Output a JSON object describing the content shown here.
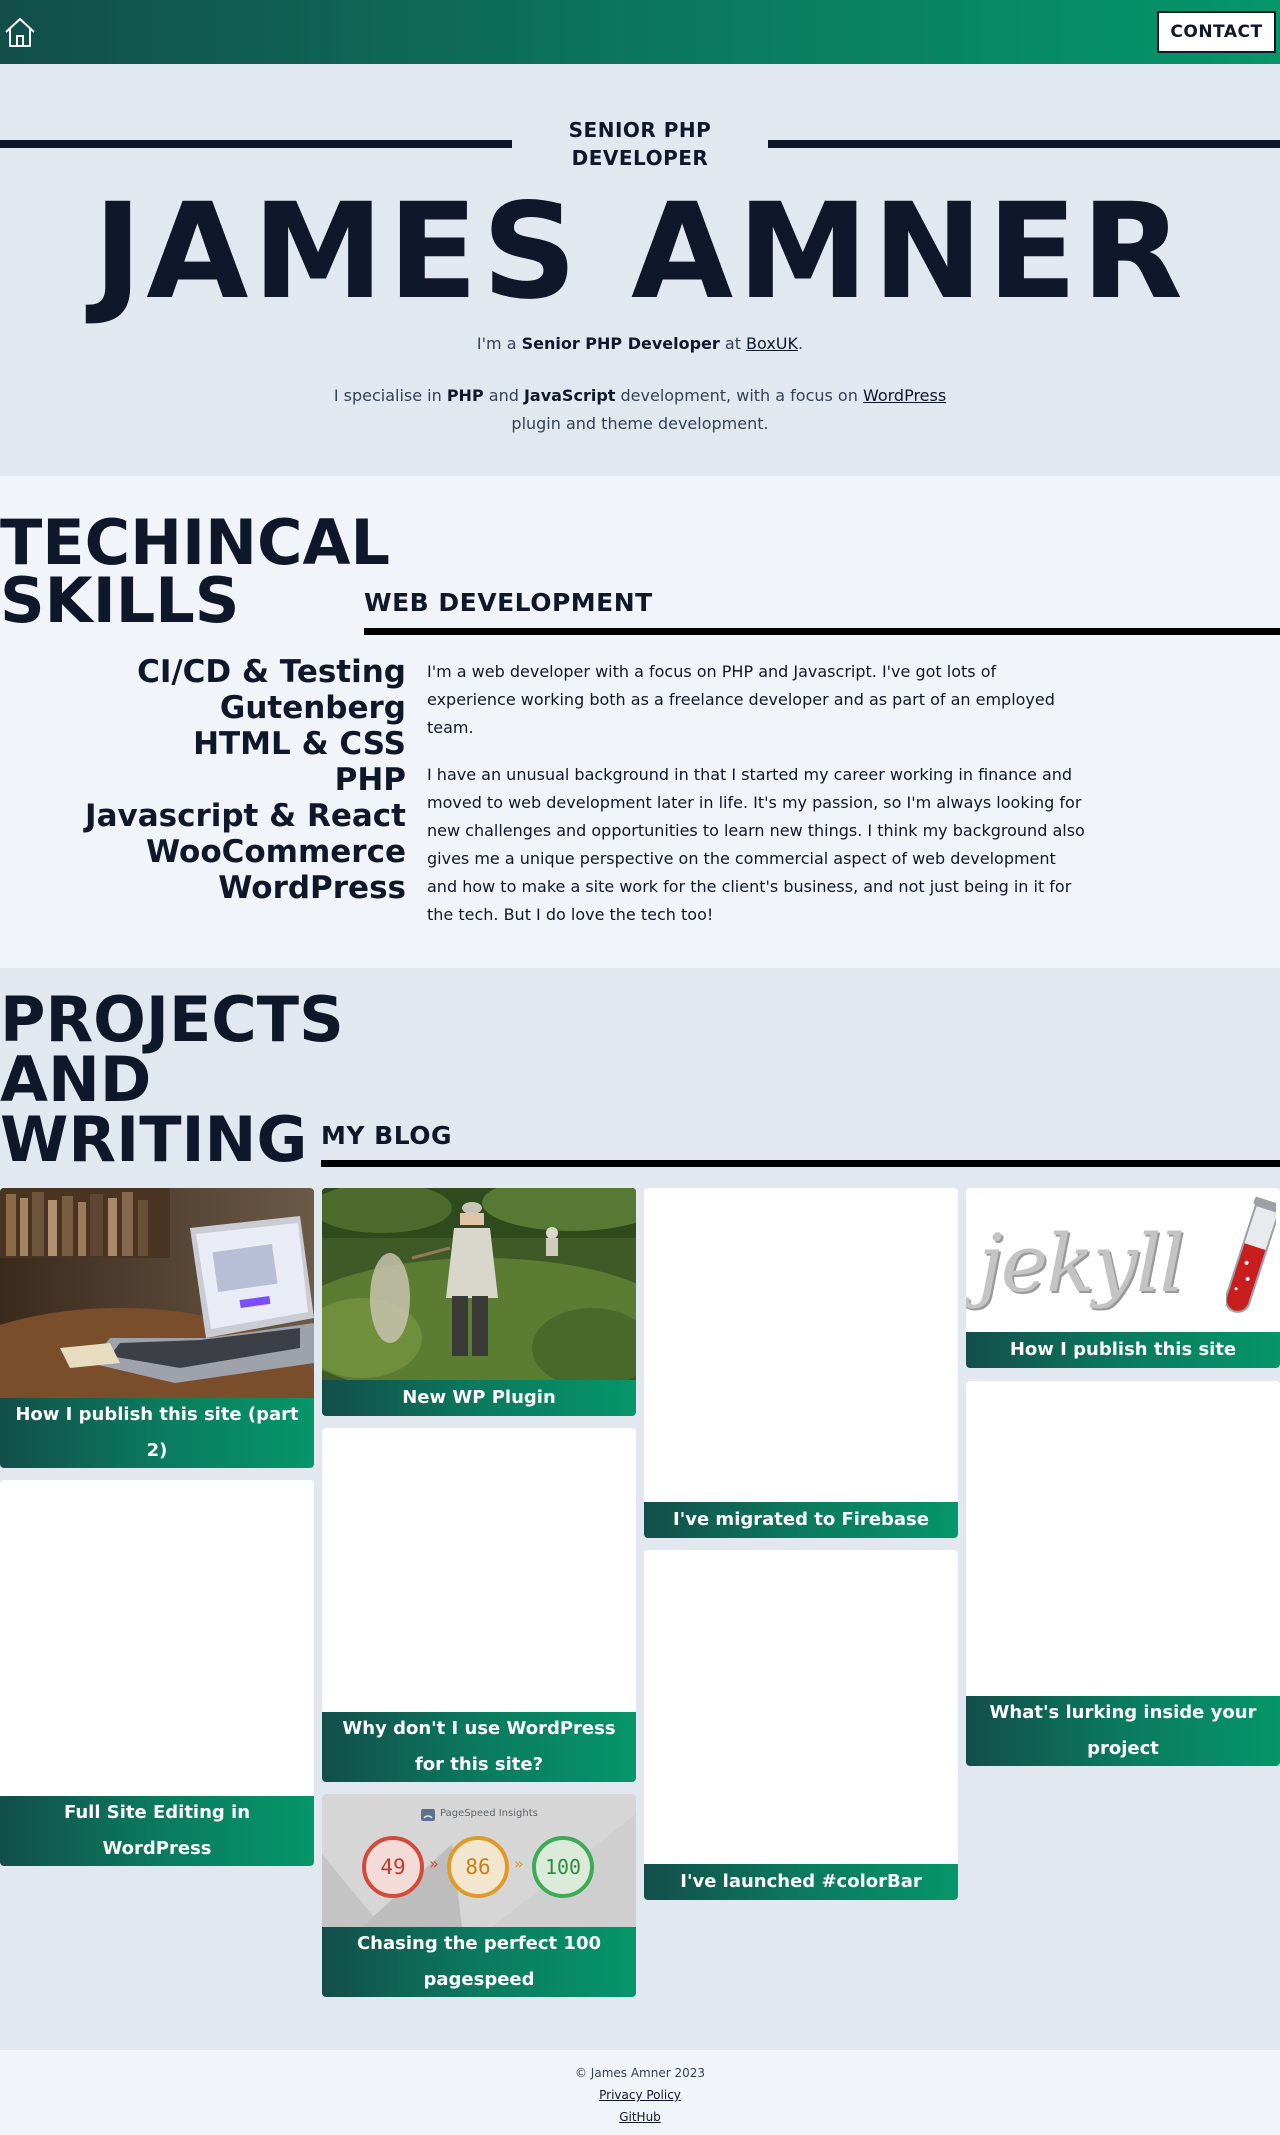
{
  "header": {
    "home_label": "Home",
    "contact_label": "CONTACT"
  },
  "hero": {
    "role": "SENIOR PHP DEVELOPER",
    "name": "JAMES AMNER",
    "intro_prefix": "I'm a ",
    "intro_role": "Senior PHP Developer",
    "intro_mid": " at ",
    "intro_company": "BoxUK",
    "intro_suffix": ".",
    "spec_prefix": "I specialise in ",
    "spec_php": "PHP",
    "spec_and": " and ",
    "spec_js": "JavaScript",
    "spec_mid": " development, with a focus on ",
    "spec_wp": "WordPress",
    "spec_suffix": " plugin and theme development."
  },
  "skills": {
    "title_line1": "TECHINCAL",
    "title_line2": "SKILLS",
    "section_heading": "WEB DEVELOPMENT",
    "list": [
      "CI/CD & Testing",
      "Gutenberg",
      "HTML & CSS",
      "PHP",
      "Javascript & React",
      "WooCommerce",
      "WordPress"
    ],
    "paragraph1": "I'm a web developer with a focus on PHP and Javascript. I've got lots of experience working both as a freelance developer and as part of an employed team.",
    "paragraph2": "I have an unusual background in that I started my career working in finance and moved to web development later in life. It's my passion, so I'm always looking for new challenges and opportunities to learn new things. I think my background also gives me a unique perspective on the commercial aspect of web development and how to make a site work for the client's business, and not just being in it for the tech. But I do love the tech too!"
  },
  "projects": {
    "title_line1": "PROJECTS",
    "title_line2": "AND",
    "title_line3": "WRITING",
    "blog_heading": "MY BLOG",
    "cards": [
      {
        "title": "How I publish this site (part 2)",
        "image": "laptop-photo"
      },
      {
        "title": "Full Site Editing in WordPress",
        "image": "none"
      },
      {
        "title": "New WP Plugin",
        "image": "bug-catcher-photo"
      },
      {
        "title": "Why don't I use WordPress for this site?",
        "image": "none"
      },
      {
        "title": "Chasing the perfect 100 pagespeed",
        "image": "pagespeed-scores"
      },
      {
        "title": "I've migrated to Firebase",
        "image": "none"
      },
      {
        "title": "I've launched #colorBar",
        "image": "none"
      },
      {
        "title": "How I publish this site",
        "image": "jekyll-logo"
      },
      {
        "title": "What's lurking inside your project",
        "image": "none"
      }
    ],
    "pagespeed": {
      "brand": "PageSpeed Insights",
      "scores": [
        "49",
        "86",
        "100"
      ],
      "arrow": "»"
    },
    "jekyll_word": "jekyll"
  },
  "footer": {
    "copyright": "© James Amner 2023",
    "privacy": "Privacy Policy",
    "github": "GitHub"
  },
  "colors": {
    "navy": "#0f172a",
    "teal_dark": "#134e4a",
    "teal_light": "#059669",
    "bg_light": "#f1f5f9",
    "bg_mid": "#e2e8f0"
  }
}
